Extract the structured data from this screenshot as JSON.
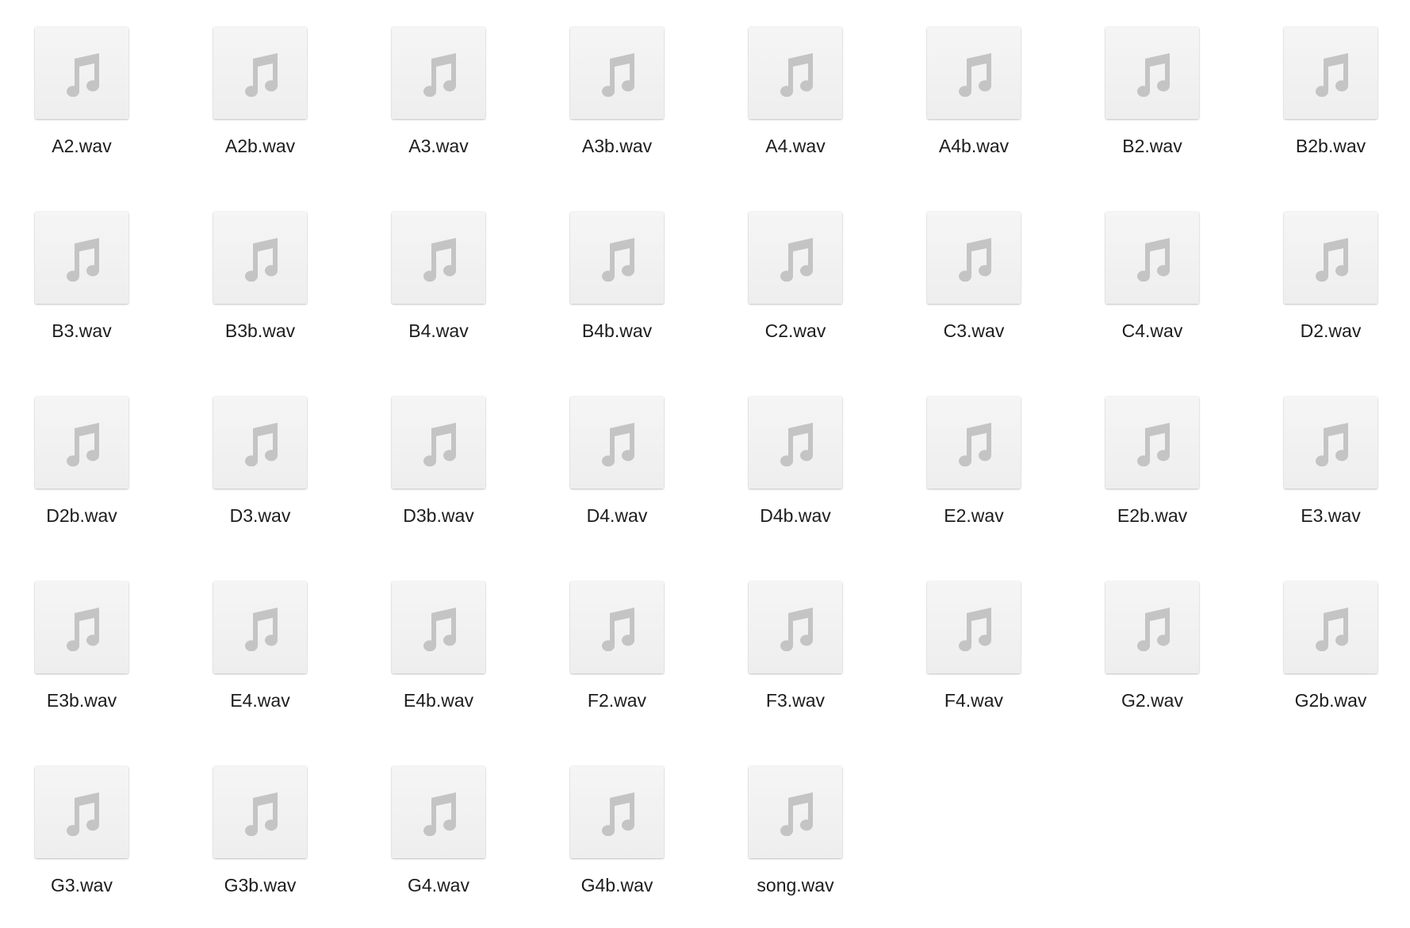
{
  "icon_color": "#c4c4c4",
  "files": [
    {
      "name": "A2.wav",
      "icon": "music-note-icon"
    },
    {
      "name": "A2b.wav",
      "icon": "music-note-icon"
    },
    {
      "name": "A3.wav",
      "icon": "music-note-icon"
    },
    {
      "name": "A3b.wav",
      "icon": "music-note-icon"
    },
    {
      "name": "A4.wav",
      "icon": "music-note-icon"
    },
    {
      "name": "A4b.wav",
      "icon": "music-note-icon"
    },
    {
      "name": "B2.wav",
      "icon": "music-note-icon"
    },
    {
      "name": "B2b.wav",
      "icon": "music-note-icon"
    },
    {
      "name": "B3.wav",
      "icon": "music-note-icon"
    },
    {
      "name": "B3b.wav",
      "icon": "music-note-icon"
    },
    {
      "name": "B4.wav",
      "icon": "music-note-icon"
    },
    {
      "name": "B4b.wav",
      "icon": "music-note-icon"
    },
    {
      "name": "C2.wav",
      "icon": "music-note-icon"
    },
    {
      "name": "C3.wav",
      "icon": "music-note-icon"
    },
    {
      "name": "C4.wav",
      "icon": "music-note-icon"
    },
    {
      "name": "D2.wav",
      "icon": "music-note-icon"
    },
    {
      "name": "D2b.wav",
      "icon": "music-note-icon"
    },
    {
      "name": "D3.wav",
      "icon": "music-note-icon"
    },
    {
      "name": "D3b.wav",
      "icon": "music-note-icon"
    },
    {
      "name": "D4.wav",
      "icon": "music-note-icon"
    },
    {
      "name": "D4b.wav",
      "icon": "music-note-icon"
    },
    {
      "name": "E2.wav",
      "icon": "music-note-icon"
    },
    {
      "name": "E2b.wav",
      "icon": "music-note-icon"
    },
    {
      "name": "E3.wav",
      "icon": "music-note-icon"
    },
    {
      "name": "E3b.wav",
      "icon": "music-note-icon"
    },
    {
      "name": "E4.wav",
      "icon": "music-note-icon"
    },
    {
      "name": "E4b.wav",
      "icon": "music-note-icon"
    },
    {
      "name": "F2.wav",
      "icon": "music-note-icon"
    },
    {
      "name": "F3.wav",
      "icon": "music-note-icon"
    },
    {
      "name": "F4.wav",
      "icon": "music-note-icon"
    },
    {
      "name": "G2.wav",
      "icon": "music-note-icon"
    },
    {
      "name": "G2b.wav",
      "icon": "music-note-icon"
    },
    {
      "name": "G3.wav",
      "icon": "music-note-icon"
    },
    {
      "name": "G3b.wav",
      "icon": "music-note-icon"
    },
    {
      "name": "G4.wav",
      "icon": "music-note-icon"
    },
    {
      "name": "G4b.wav",
      "icon": "music-note-icon"
    },
    {
      "name": "song.wav",
      "icon": "music-note-icon"
    }
  ]
}
